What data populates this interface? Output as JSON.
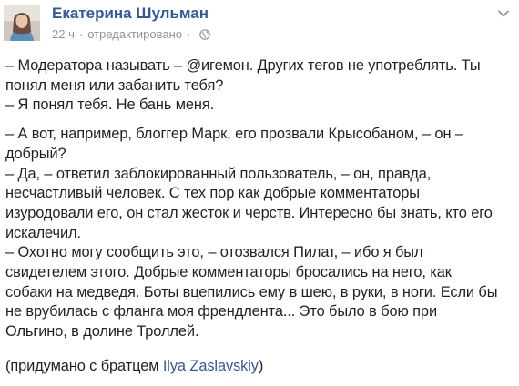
{
  "post": {
    "author": "Екатерина Шульман",
    "time": "22 ч",
    "separator": "·",
    "edited": "отредактировано",
    "privacy_icon": "globe-icon",
    "menu_icon": "chevron-down-icon",
    "avatar_icon": "profile-photo"
  },
  "paragraphs": [
    {
      "lines": [
        "– Модератора называть – @игемон. Других тегов не употреблять. Ты",
        "понял меня или забанить тебя?",
        "– Я понял тебя. Не бань меня."
      ]
    },
    {
      "lines": [
        "– А вот, например, блоггер Марк, его прозвали Крысобаном, – он –",
        "добрый?",
        "– Да, – ответил заблокированный пользователь, – он, правда,",
        "несчастливый человек. С тех пор как добрые комментаторы",
        "изуродовали его, он стал жесток и черств. Интересно бы знать, кто его",
        "искалечил.",
        "– Охотно могу сообщить это, – отозвался Пилат, – ибо я был",
        "свидетелем этого. Добрые комментаторы бросались на него, как",
        "собаки на медведя. Боты вцепились ему в шею, в руки, в ноги. Если бы",
        "не врубилась с фланга моя френдлента... Это было в бою при",
        "Ольгино, в долине Троллей."
      ]
    }
  ],
  "credit": {
    "prefix": "(придумано с братцем ",
    "link": "Ilya Zaslavskiy",
    "suffix": ")"
  }
}
